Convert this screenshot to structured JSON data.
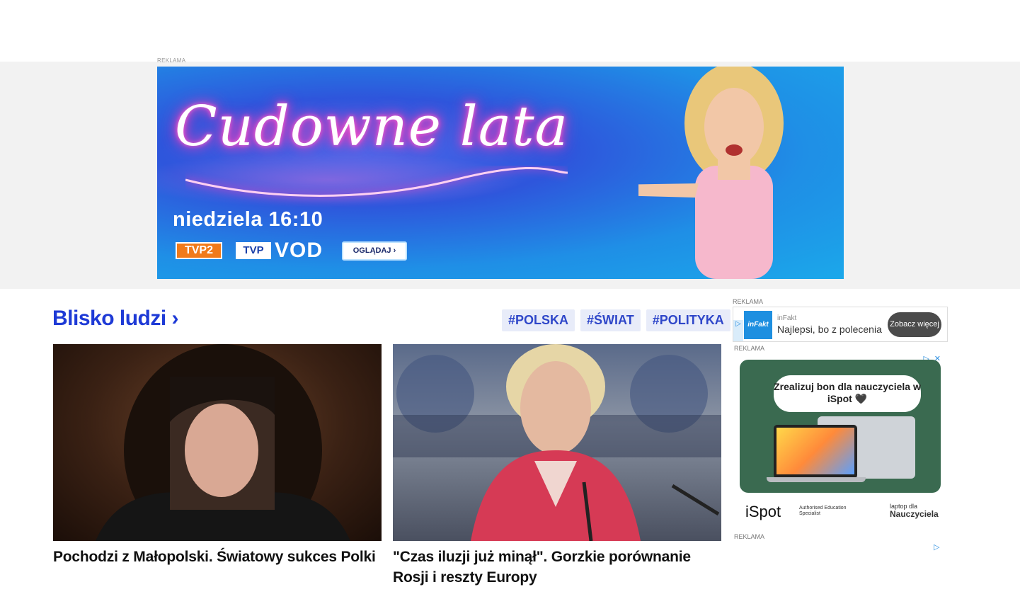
{
  "ads": {
    "top_label": "REKLAMA",
    "banner": {
      "title": "Cudowne lata",
      "schedule": "niedziela 16:10",
      "channel": "TVP2",
      "tvp": "TVP",
      "vod": "VOD",
      "cta": "OGLĄDAJ ›"
    },
    "side1": {
      "label": "REKLAMA",
      "logo": "inFakt",
      "brand": "inFakt",
      "message": "Najlepsi, bo z polecenia",
      "cta": "Zobacz więcej"
    },
    "side2": {
      "label": "REKLAMA",
      "bubble": "Zrealizuj bon dla nauczyciela w iSpot 🖤",
      "brand": "iSpot",
      "apple_text": "Authorised Education Specialist",
      "laptop_small": "laptop dla",
      "laptop_big": "Nauczyciela"
    },
    "side3": {
      "label": "REKLAMA"
    }
  },
  "section": {
    "title": "Blisko ludzi ›",
    "tags": [
      "#POLSKA",
      "#ŚWIAT",
      "#POLITYKA"
    ]
  },
  "articles": [
    {
      "headline": "Pochodzi z Małopolski. Światowy sukces Polki"
    },
    {
      "headline": "\"Czas iluzji już minął\". Gorzkie porównanie Rosji i reszty Europy"
    }
  ]
}
